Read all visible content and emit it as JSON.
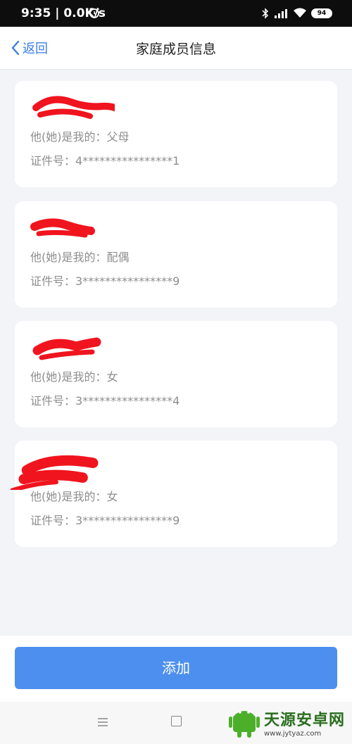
{
  "status_bar": {
    "time": "9:35 | 0.0K/s",
    "battery": "94"
  },
  "nav": {
    "back_label": "返回",
    "title": "家庭成员信息"
  },
  "members": [
    {
      "relation": "他(她)是我的：父母",
      "id_number": "证件号：4****************1"
    },
    {
      "relation": "他(她)是我的：配偶",
      "id_number": "证件号：3****************9"
    },
    {
      "relation": "他(她)是我的：女",
      "id_number": "证件号：3****************4"
    },
    {
      "relation": "他(她)是我的：女",
      "id_number": "证件号：3****************9"
    }
  ],
  "add_button_label": "添加",
  "watermark": {
    "name": "天源安卓网",
    "url": "www.jytyaz.com"
  },
  "colors": {
    "accent": "#3a7fe8",
    "button": "#4d8fee",
    "redaction": "#f0141e",
    "background": "#f3f4f8"
  }
}
